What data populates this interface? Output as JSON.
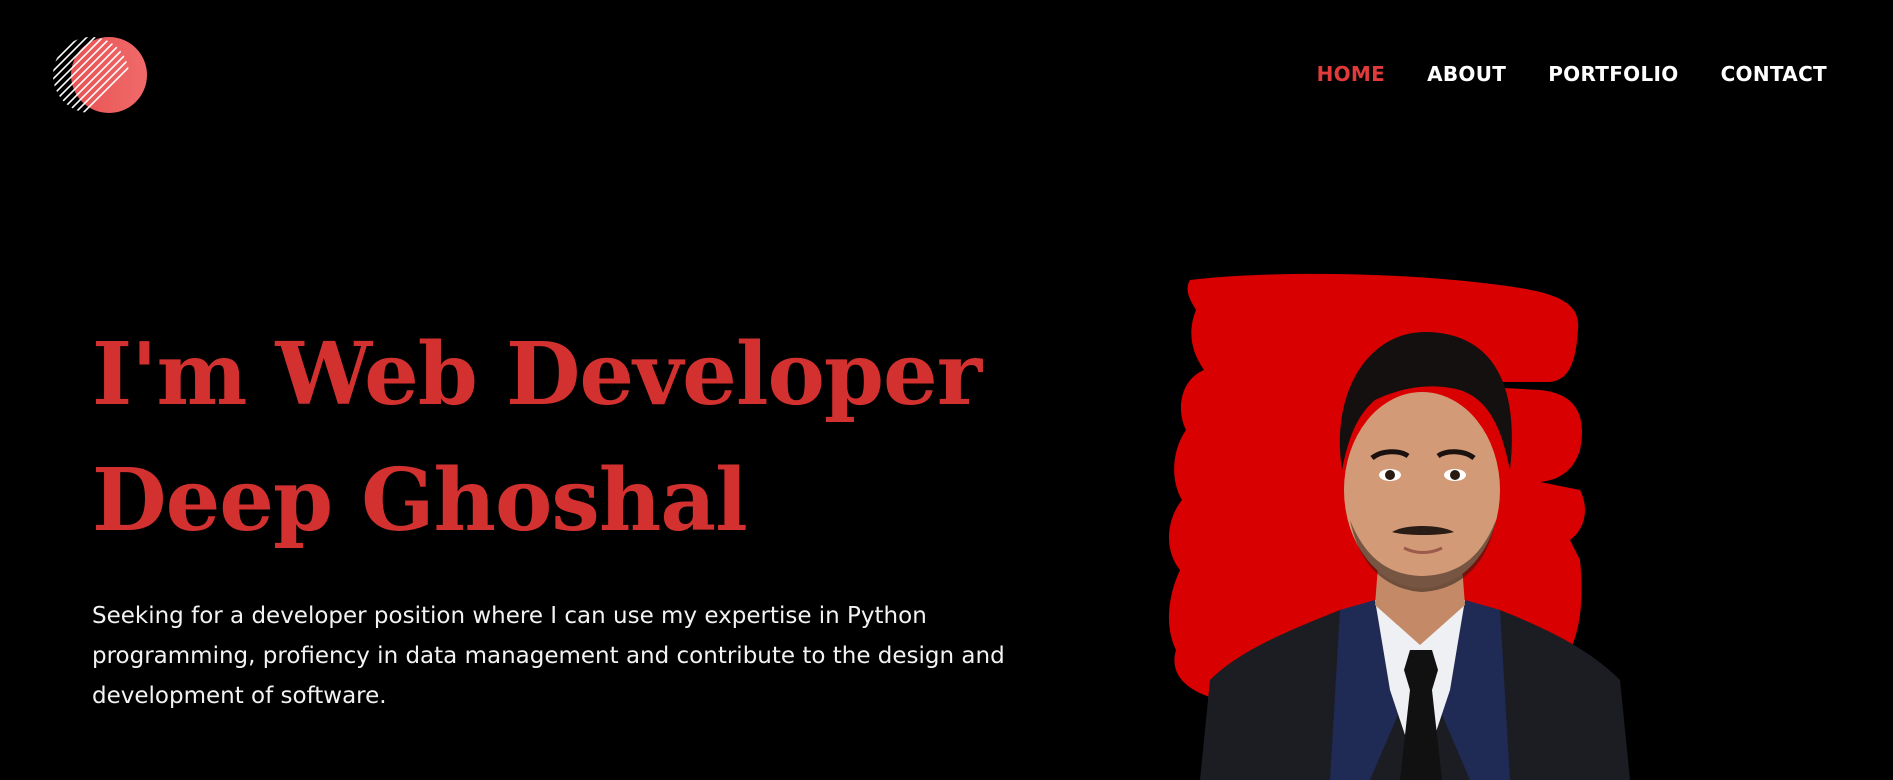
{
  "brand": {
    "logo_icon": "striped-circle-logo-icon",
    "accent": "#e03a3a"
  },
  "nav": {
    "items": [
      {
        "label": "HOME",
        "active": true
      },
      {
        "label": "ABOUT",
        "active": false
      },
      {
        "label": "PORTFOLIO",
        "active": false
      },
      {
        "label": "CONTACT",
        "active": false
      }
    ]
  },
  "hero": {
    "title_line1": "I'm Web Developer",
    "title_line2": "Deep Ghoshal",
    "title_color": "#d3312f",
    "description": "Seeking for a developer position where I can use my expertise in Python programming, profiency in data management and contribute to the design and development of software.",
    "portrait": {
      "icon": "profile-portrait",
      "backdrop_color": "#d80000"
    }
  },
  "colors": {
    "background": "#000000",
    "text": "#ffffff"
  }
}
